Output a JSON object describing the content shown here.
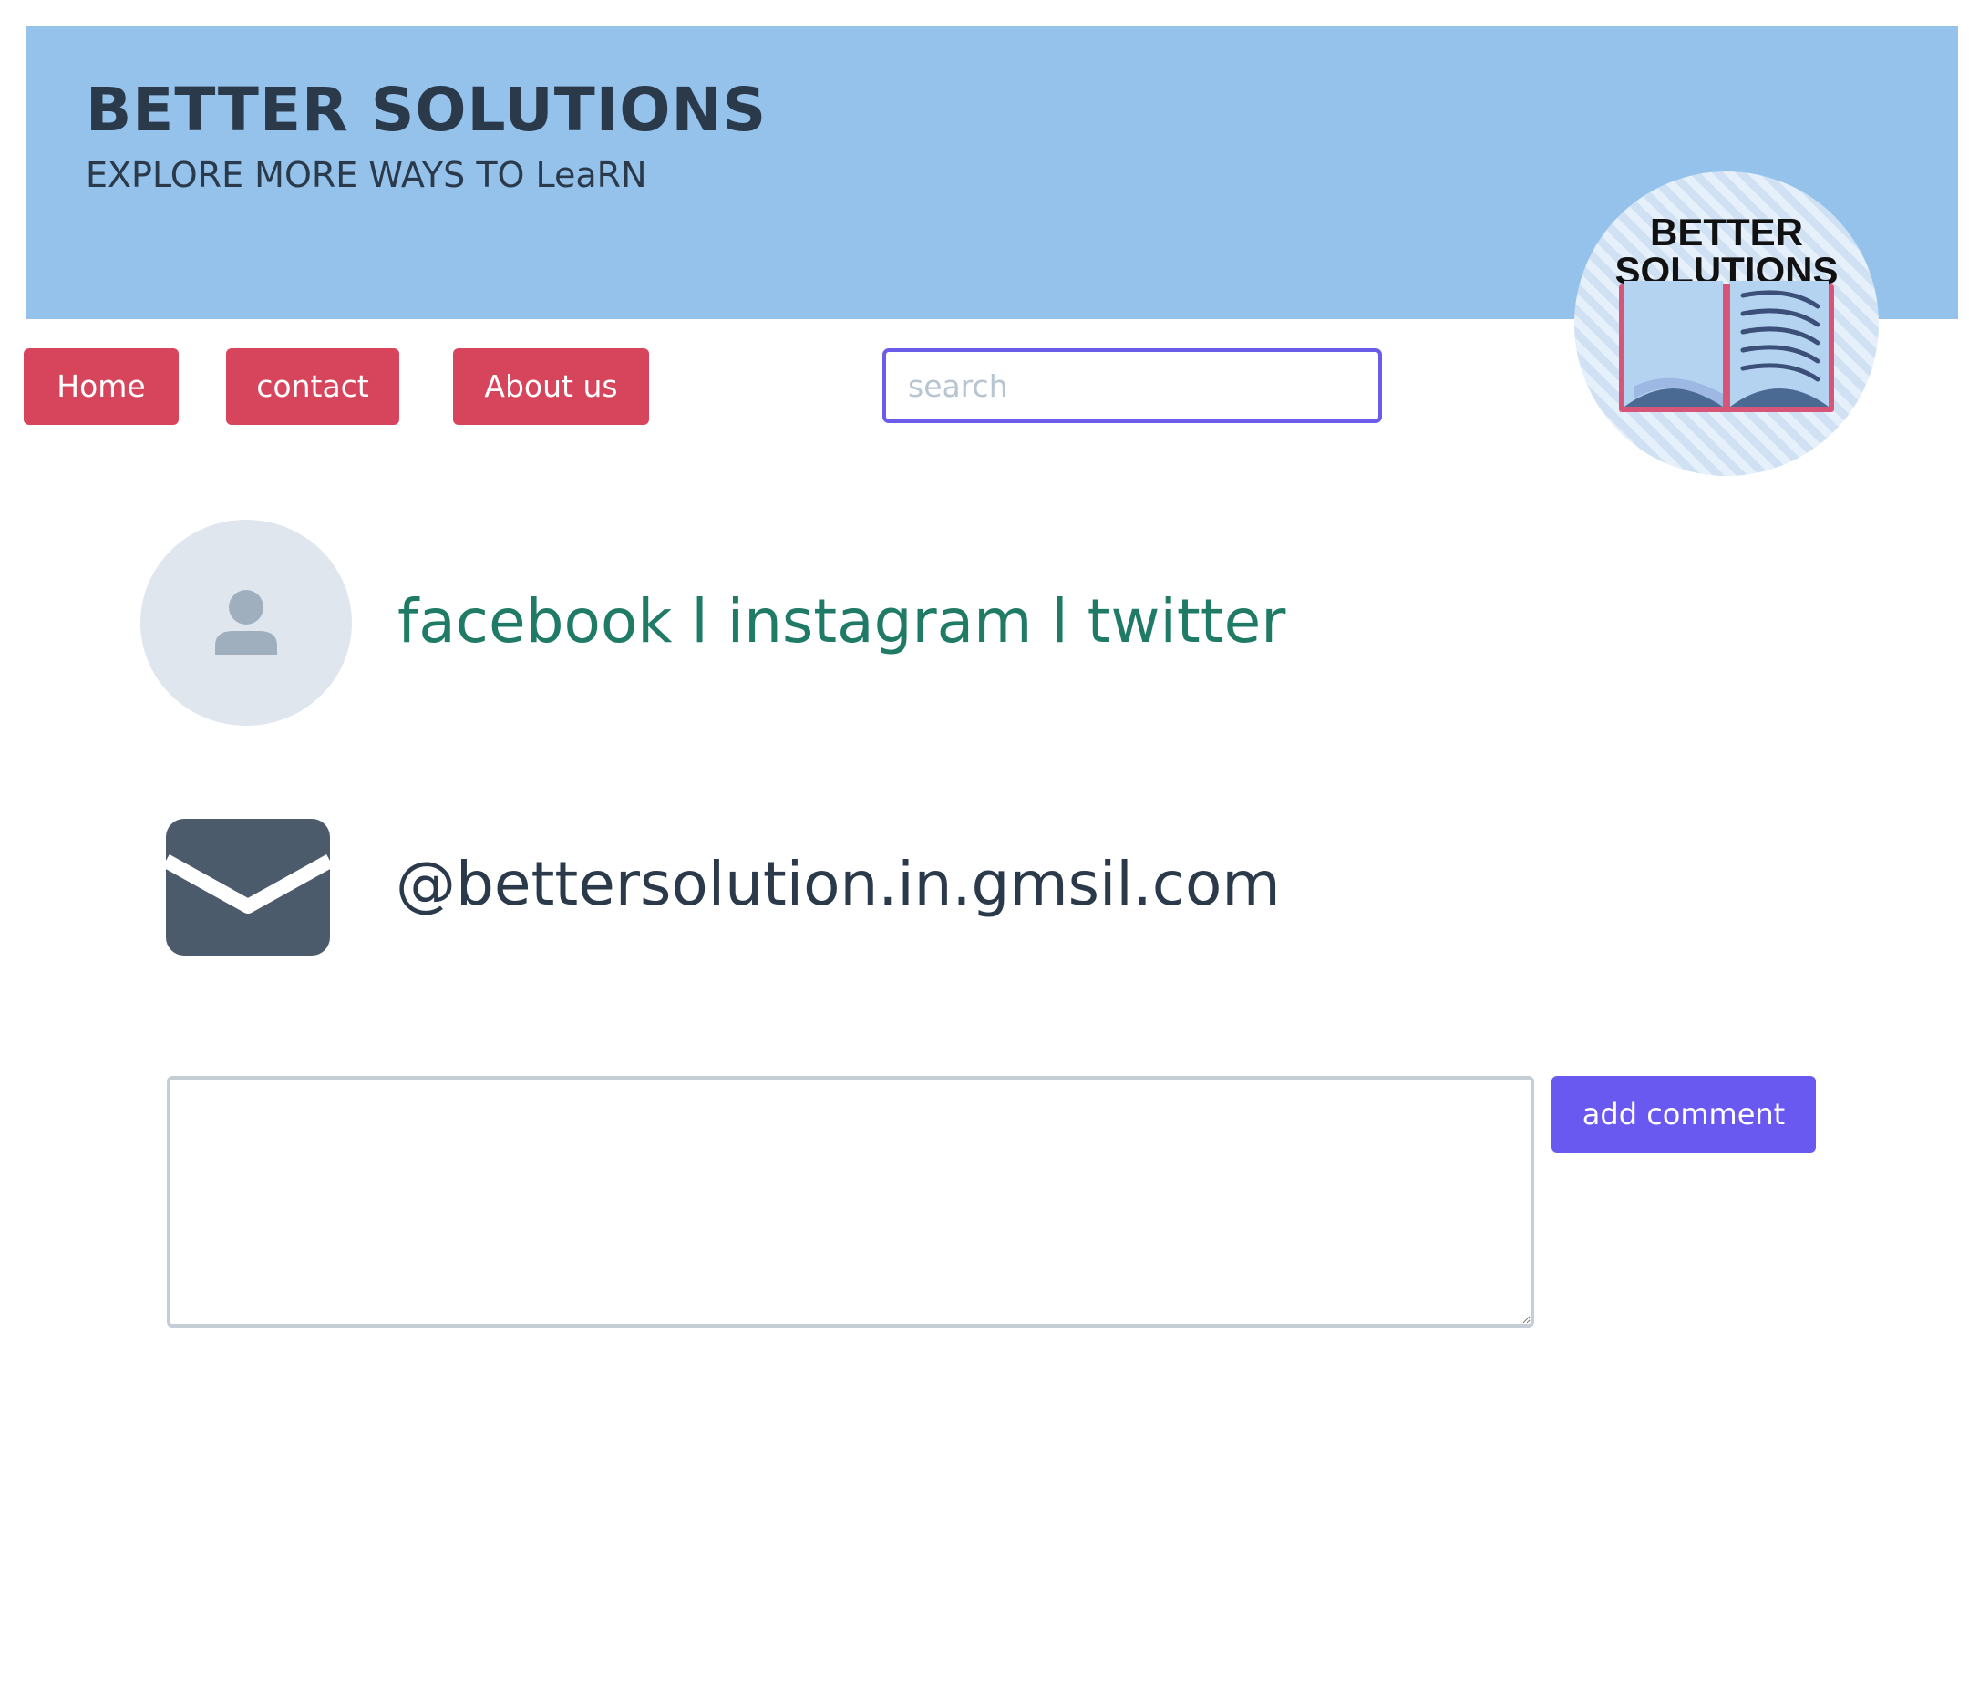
{
  "header": {
    "title": "BETTER SOLUTIONS",
    "subtitle": "EXPLORE MORE WAYS TO LeaRN",
    "background_color": "#95c2eb"
  },
  "logo": {
    "text_line1": "BETTER",
    "text_line2": "SOLUTIONS",
    "icon": "open-book-icon"
  },
  "nav": {
    "items": [
      {
        "label": "Home"
      },
      {
        "label": "contact"
      },
      {
        "label": "About us"
      }
    ],
    "button_color": "#d6455b"
  },
  "search": {
    "placeholder": "search",
    "value": "",
    "border_color": "#6a5be8"
  },
  "social": {
    "avatar_icon": "user-avatar-icon",
    "text": "facebook l instagram l twitter",
    "text_color": "#1f7a66"
  },
  "contact_email": {
    "icon": "envelope-icon",
    "text": "@bettersolution.in.gmsil.com"
  },
  "comment": {
    "value": "",
    "button_label": "add comment",
    "button_color": "#6a59f0"
  }
}
